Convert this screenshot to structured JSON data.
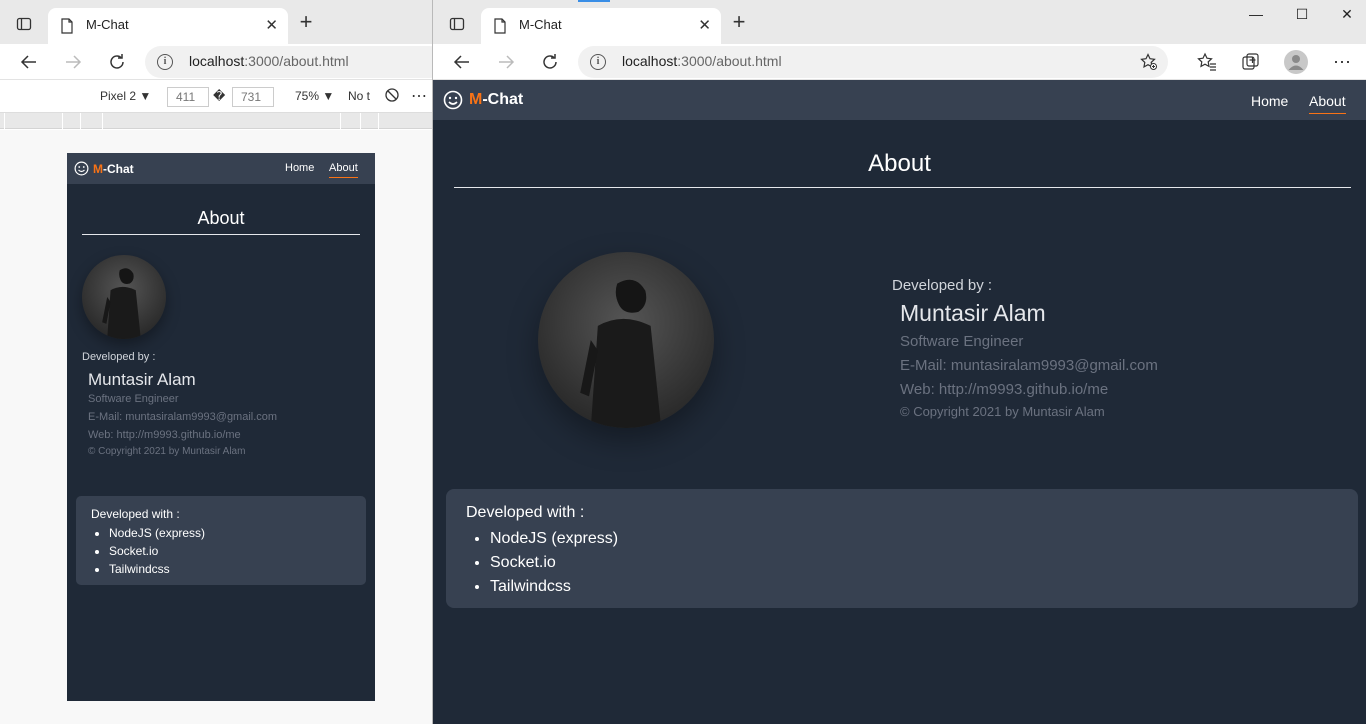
{
  "tab": {
    "title": "M-Chat",
    "close": "✕",
    "new_tab": "+"
  },
  "address": {
    "host": "localhost",
    "path": ":3000/about.html"
  },
  "window_controls": {
    "minimize": "—",
    "maximize": "☐",
    "close": "✕"
  },
  "devtools": {
    "device": "Pixel 2 ▼",
    "width": "411",
    "swap": "�",
    "height": "731",
    "zoom": "75% ▼",
    "throttle": "No t",
    "more": "⋯"
  },
  "page": {
    "brand_m": "M",
    "brand_rest": "-Chat",
    "nav": {
      "home": "Home",
      "about": "About"
    },
    "title": "About",
    "developer": {
      "label": "Developed by :",
      "name": "Muntasir Alam",
      "role": "Software Engineer",
      "email": "E-Mail: muntasiralam9993@gmail.com",
      "web": "Web: http://m9993.github.io/me",
      "copyright": "© Copyright 2021 by Muntasir Alam"
    },
    "tech": {
      "title": "Developed with :",
      "items": [
        "NodeJS (express)",
        "Socket.io",
        "Tailwindcss"
      ]
    }
  },
  "colors": {
    "page_bg": "#1f2937",
    "nav_bg": "#374151",
    "accent": "#f97316",
    "muted_text": "#6b7280"
  },
  "icons": [
    "tab-actions-icon",
    "page-icon",
    "back-icon",
    "forward-icon",
    "refresh-icon",
    "info-icon",
    "favorite-add-icon",
    "favorites-icon",
    "collections-icon",
    "profile-icon",
    "more-icon",
    "smiley-icon",
    "rotate-icon"
  ]
}
